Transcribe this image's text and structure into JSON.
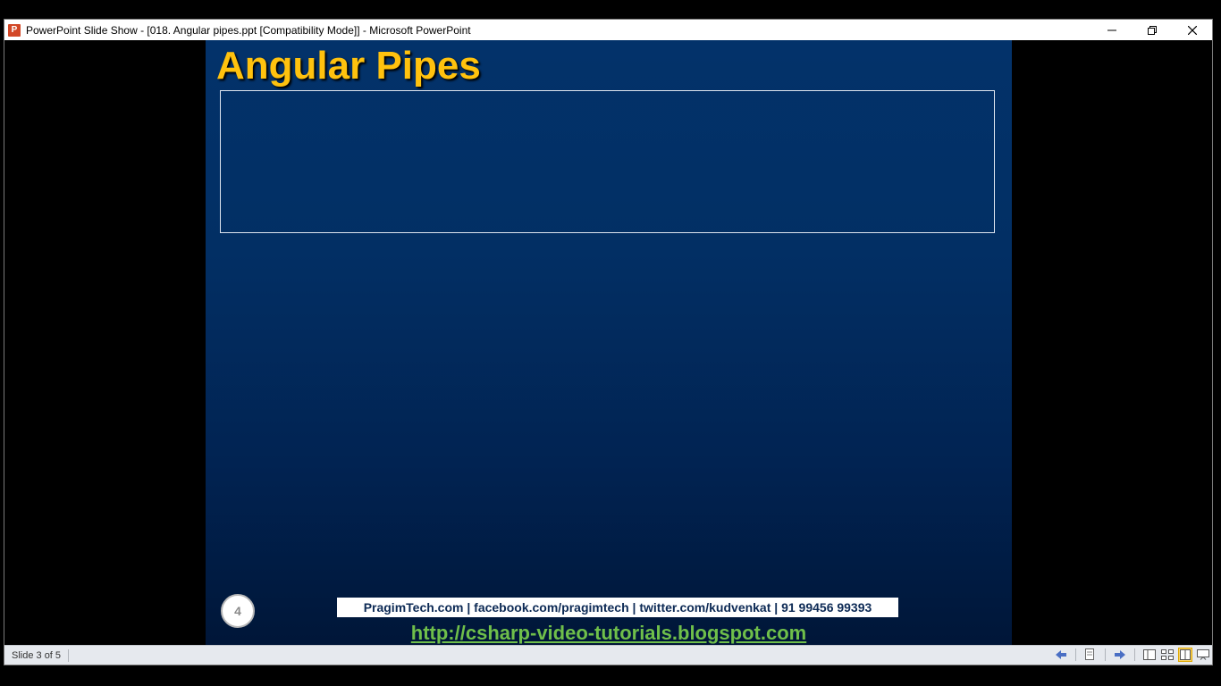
{
  "window": {
    "app_icon_letter": "P",
    "title": "PowerPoint Slide Show - [018. Angular pipes.ppt [Compatibility Mode]] - Microsoft PowerPoint"
  },
  "slide": {
    "title": "Angular Pipes",
    "number": "4",
    "footer_text": "PragimTech.com | facebook.com/pragimtech  | twitter.com/kudvenkat  | 91 99456 99393",
    "footer_link": "http://csharp-video-tutorials.blogspot.com"
  },
  "statusbar": {
    "slide_info": "Slide 3 of 5"
  },
  "colors": {
    "title": "#ffc20e",
    "link": "#6fbf4a",
    "slide_bg_top": "#03326a",
    "slide_bg_bottom": "#001638"
  },
  "icons": [
    "app-icon",
    "minimize-icon",
    "restore-icon",
    "close-icon",
    "previous-icon",
    "menu-icon",
    "next-icon",
    "normal-view-icon",
    "slide-sorter-icon",
    "reading-view-icon",
    "slideshow-icon"
  ]
}
